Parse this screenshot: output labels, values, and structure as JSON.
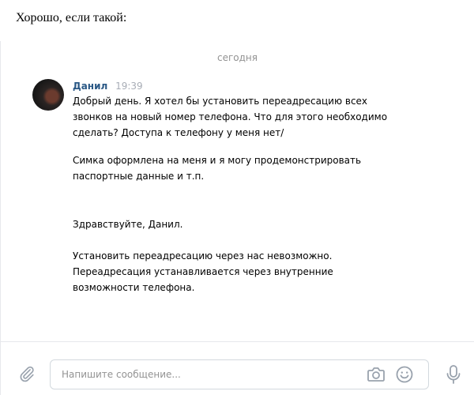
{
  "caption": "Хорошо, если такой:",
  "chat": {
    "date_divider": "сегодня",
    "message": {
      "author": "Данил",
      "time": "19:39",
      "lines": [
        "Добрый день. Я хотел бы установить переадресацию всех",
        "звонков на новый номер телефона. Что для этого необходимо",
        "сделать? Доступа к телефону у меня нет/",
        "Симка оформлена на меня и я могу продемонстрировать",
        "паспортные данные и т.п.",
        "Здравствуйте, Данил.",
        "Установить переадресацию через нас невозможно.",
        "Переадресация устанавливается через внутренние",
        "возможности телефона."
      ]
    }
  },
  "input_bar": {
    "placeholder": "Напишите сообщение...",
    "icons": {
      "attach": "paperclip-icon",
      "camera": "camera-icon",
      "emoji": "emoji-icon",
      "mic": "microphone-icon"
    }
  },
  "colors": {
    "author": "#2a5885",
    "muted": "#939393",
    "border": "#d3d9de",
    "icon": "#99a2ad"
  }
}
